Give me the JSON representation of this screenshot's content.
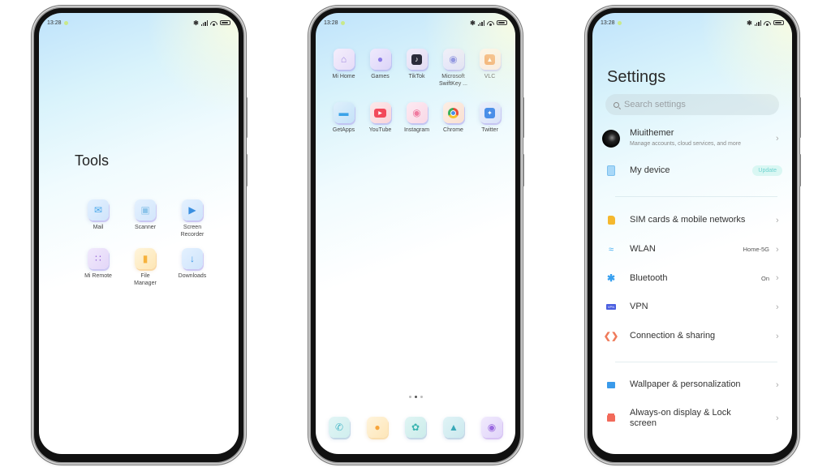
{
  "status_bar": {
    "time": "13:28",
    "icons": [
      "bluetooth-icon",
      "signal-icon",
      "wifi-icon",
      "battery-icon"
    ]
  },
  "tools_screen": {
    "folder_title": "Tools",
    "apps": [
      {
        "label": "Mail",
        "icon": "mail-icon",
        "color": "#4aa8ea"
      },
      {
        "label": "Scanner",
        "icon": "scanner-icon",
        "color": "#8cc4ea"
      },
      {
        "label": "Screen Recorder",
        "icon": "screen-recorder-icon",
        "color": "#3a8fe0"
      },
      {
        "label": "Mi Remote",
        "icon": "remote-icon",
        "color": "#9b6ad8"
      },
      {
        "label": "File Manager",
        "icon": "folder-icon",
        "color": "#f6b23c"
      },
      {
        "label": "Downloads",
        "icon": "download-icon",
        "color": "#3a97e6"
      }
    ]
  },
  "home_screen": {
    "apps": [
      {
        "label": "Mi Home",
        "icon": "mi-home-icon",
        "color": "#a48ce0"
      },
      {
        "label": "Games",
        "icon": "games-icon",
        "color": "#8a7ae6"
      },
      {
        "label": "TikTok",
        "icon": "tiktok-icon",
        "color": "#2b2b3a"
      },
      {
        "label": "Microsoft SwiftKey ...",
        "icon": "swiftkey-icon",
        "color": "#7c82e0"
      },
      {
        "label": "VLC",
        "icon": "vlc-icon",
        "color": "#f08a3a"
      },
      {
        "label": "GetApps",
        "icon": "getapps-icon",
        "color": "#3aa2e8"
      },
      {
        "label": "YouTube",
        "icon": "youtube-icon",
        "color": "#f2495a"
      },
      {
        "label": "Instagram",
        "icon": "instagram-icon",
        "color": "#f07aa0"
      },
      {
        "label": "Chrome",
        "icon": "chrome-icon",
        "color": "#f0a030"
      },
      {
        "label": "Twitter",
        "icon": "twitter-icon",
        "color": "#4a8ee8"
      }
    ],
    "page_indicator": {
      "pages": 3,
      "current": 2
    },
    "dock": [
      {
        "icon": "phone-icon",
        "color": "#4ab8c8"
      },
      {
        "icon": "messages-icon",
        "color": "#f7a43a"
      },
      {
        "icon": "browser-icon",
        "color": "#3ab4b0"
      },
      {
        "icon": "gallery-icon",
        "color": "#3aa8b8"
      },
      {
        "icon": "camera-icon",
        "color": "#9b6ae0"
      }
    ]
  },
  "settings_screen": {
    "title": "Settings",
    "search_placeholder": "Search settings",
    "account": {
      "name": "Miuithemer",
      "subtitle": "Manage accounts, cloud services, and more"
    },
    "my_device": {
      "label": "My device",
      "badge": "Update"
    },
    "items": [
      {
        "label": "SIM cards & mobile networks",
        "value": "",
        "icon": "sim-card-icon",
        "color": "#f5b82e"
      },
      {
        "label": "WLAN",
        "value": "Home-5G",
        "icon": "wifi-icon",
        "color": "#38a8f0"
      },
      {
        "label": "Bluetooth",
        "value": "On",
        "icon": "bluetooth-icon",
        "color": "#38a0f0"
      },
      {
        "label": "VPN",
        "value": "",
        "icon": "vpn-icon",
        "color": "#4a5ee0"
      },
      {
        "label": "Connection & sharing",
        "value": "",
        "icon": "connection-sharing-icon",
        "color": "#ef7a5a"
      },
      {
        "label": "Wallpaper & personalization",
        "value": "",
        "icon": "wallpaper-icon",
        "color": "#3a9aea"
      },
      {
        "label": "Always-on display & Lock screen",
        "value": "",
        "icon": "lock-icon",
        "color": "#f26a5a"
      }
    ]
  }
}
